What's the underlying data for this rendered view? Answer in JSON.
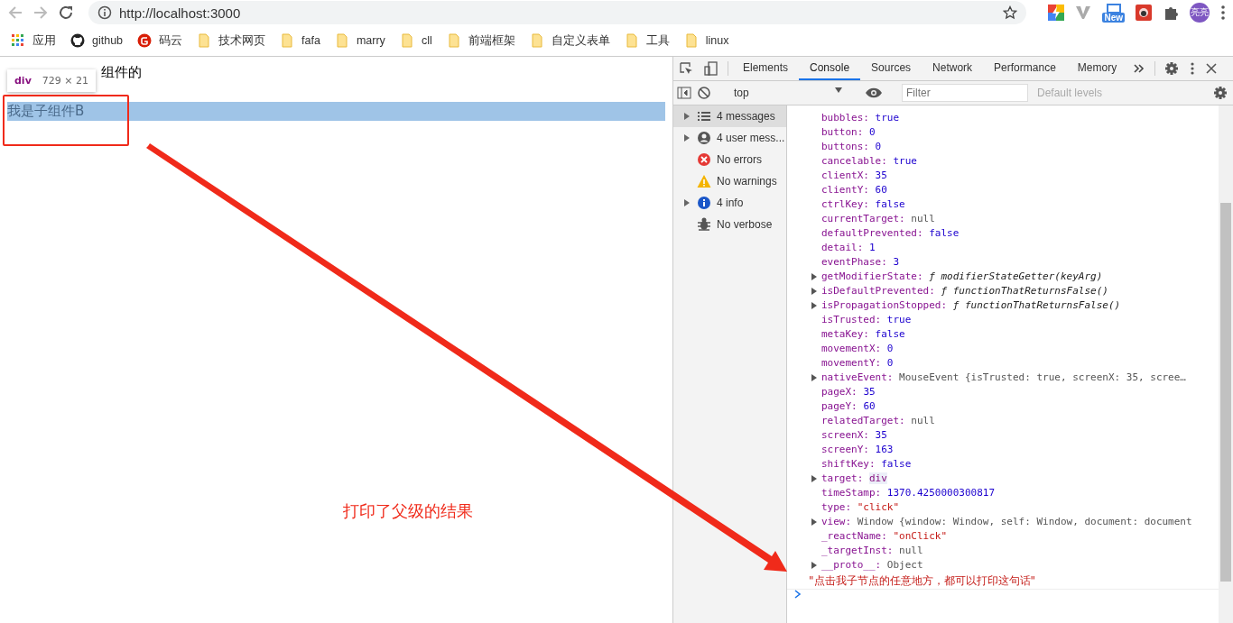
{
  "browser": {
    "url": "http://localhost:3000",
    "starred": false,
    "bookmarks": [
      {
        "label": "应用",
        "kind": "apps"
      },
      {
        "label": "github",
        "kind": "github"
      },
      {
        "label": "码云",
        "kind": "gitee"
      },
      {
        "label": "技术网页",
        "kind": "folder"
      },
      {
        "label": "fafa",
        "kind": "folder"
      },
      {
        "label": "marry",
        "kind": "folder"
      },
      {
        "label": "cll",
        "kind": "folder"
      },
      {
        "label": "前端框架",
        "kind": "folder"
      },
      {
        "label": "自定义表单",
        "kind": "folder"
      },
      {
        "label": "工具",
        "kind": "folder"
      },
      {
        "label": "linux",
        "kind": "folder"
      }
    ],
    "new_badge": "New",
    "avatar": "亮亮"
  },
  "page": {
    "first_line_visible": "组件的",
    "highlighted_line": "我是子组件B",
    "tooltip": {
      "tag": "div",
      "size": "729 × 21"
    },
    "annotation": "打印了父级的结果"
  },
  "devtools": {
    "tabs": [
      {
        "label": "Elements",
        "selected": false
      },
      {
        "label": "Console",
        "selected": true
      },
      {
        "label": "Sources",
        "selected": false
      },
      {
        "label": "Network",
        "selected": false
      },
      {
        "label": "Performance",
        "selected": false
      },
      {
        "label": "Memory",
        "selected": false
      }
    ],
    "context": "top",
    "filter_placeholder": "Filter",
    "levels": "Default levels",
    "sidebar": [
      {
        "label": "4 messages",
        "kind": "list",
        "expandable": true,
        "selected": true
      },
      {
        "label": "4 user mess...",
        "kind": "user",
        "expandable": true,
        "selected": false
      },
      {
        "label": "No errors",
        "kind": "error",
        "expandable": false,
        "selected": false
      },
      {
        "label": "No warnings",
        "kind": "warning",
        "expandable": false,
        "selected": false
      },
      {
        "label": "4 info",
        "kind": "info",
        "expandable": true,
        "selected": false
      },
      {
        "label": "No verbose",
        "kind": "verbose",
        "expandable": false,
        "selected": false
      }
    ],
    "properties": [
      {
        "key": "bubbles:",
        "value": "true",
        "kind": "bool",
        "expandable": false
      },
      {
        "key": "button:",
        "value": "0",
        "kind": "num",
        "expandable": false
      },
      {
        "key": "buttons:",
        "value": "0",
        "kind": "num",
        "expandable": false
      },
      {
        "key": "cancelable:",
        "value": "true",
        "kind": "bool",
        "expandable": false
      },
      {
        "key": "clientX:",
        "value": "35",
        "kind": "num",
        "expandable": false
      },
      {
        "key": "clientY:",
        "value": "60",
        "kind": "num",
        "expandable": false
      },
      {
        "key": "ctrlKey:",
        "value": "false",
        "kind": "bool",
        "expandable": false
      },
      {
        "key": "currentTarget:",
        "value": "null",
        "kind": "null",
        "expandable": false
      },
      {
        "key": "defaultPrevented:",
        "value": "false",
        "kind": "bool",
        "expandable": false
      },
      {
        "key": "detail:",
        "value": "1",
        "kind": "num",
        "expandable": false
      },
      {
        "key": "eventPhase:",
        "value": "3",
        "kind": "num",
        "expandable": false
      },
      {
        "key": "getModifierState:",
        "value": "ƒ modifierStateGetter(keyArg)",
        "kind": "fn",
        "expandable": true
      },
      {
        "key": "isDefaultPrevented:",
        "value": "ƒ functionThatReturnsFalse()",
        "kind": "fn",
        "expandable": true
      },
      {
        "key": "isPropagationStopped:",
        "value": "ƒ functionThatReturnsFalse()",
        "kind": "fn",
        "expandable": true
      },
      {
        "key": "isTrusted:",
        "value": "true",
        "kind": "bool",
        "expandable": false
      },
      {
        "key": "metaKey:",
        "value": "false",
        "kind": "bool",
        "expandable": false
      },
      {
        "key": "movementX:",
        "value": "0",
        "kind": "num",
        "expandable": false
      },
      {
        "key": "movementY:",
        "value": "0",
        "kind": "num",
        "expandable": false
      },
      {
        "key": "nativeEvent:",
        "value": "MouseEvent {isTrusted: true, screenX: 35, scree…",
        "kind": "preview",
        "expandable": true
      },
      {
        "key": "pageX:",
        "value": "35",
        "kind": "num",
        "expandable": false
      },
      {
        "key": "pageY:",
        "value": "60",
        "kind": "num",
        "expandable": false
      },
      {
        "key": "relatedTarget:",
        "value": "null",
        "kind": "null",
        "expandable": false
      },
      {
        "key": "screenX:",
        "value": "35",
        "kind": "num",
        "expandable": false
      },
      {
        "key": "screenY:",
        "value": "163",
        "kind": "num",
        "expandable": false
      },
      {
        "key": "shiftKey:",
        "value": "false",
        "kind": "bool",
        "expandable": false
      },
      {
        "key": "target:",
        "value": "div",
        "kind": "node",
        "expandable": true
      },
      {
        "key": "timeStamp:",
        "value": "1370.4250000300817",
        "kind": "num",
        "expandable": false
      },
      {
        "key": "type:",
        "value": "\"click\"",
        "kind": "str",
        "expandable": false
      },
      {
        "key": "view:",
        "value": "Window {window: Window, self: Window, document: document",
        "kind": "preview",
        "expandable": true
      },
      {
        "key": "_reactName:",
        "value": "\"onClick\"",
        "kind": "str",
        "expandable": false
      },
      {
        "key": "_targetInst:",
        "value": "null",
        "kind": "null",
        "expandable": false
      },
      {
        "key": "__proto__:",
        "value": "Object",
        "kind": "obj",
        "expandable": true
      }
    ],
    "log_message": "\"点击我子节点的任意地方，都可以打印这句话\""
  }
}
